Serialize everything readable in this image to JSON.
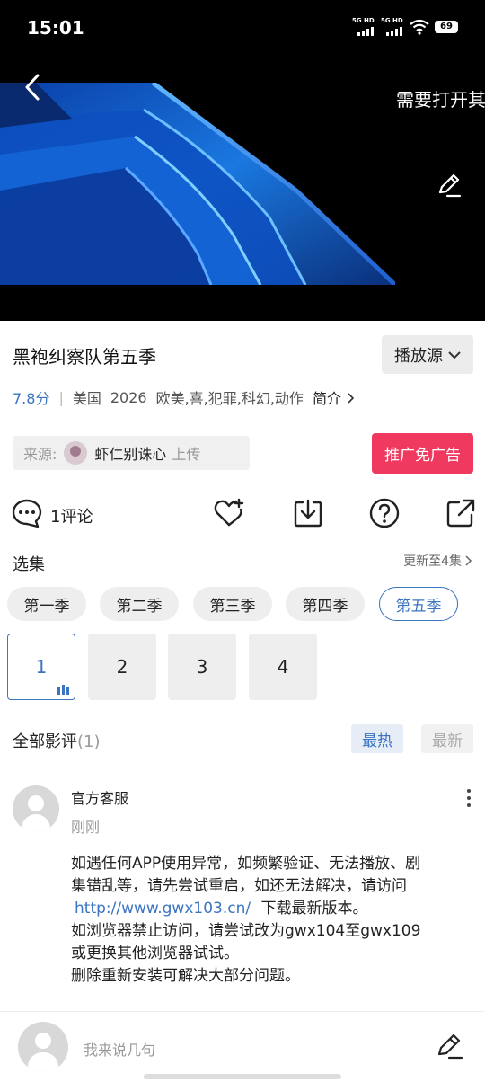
{
  "status_bar": {
    "time": "15:01",
    "sim1": "5G HD",
    "sim2": "5G HD",
    "battery": "69"
  },
  "hero": {
    "marquee": "需要打开其"
  },
  "show": {
    "title": "黑袍纠察队第五季",
    "source_button": "播放源",
    "score": "7.8分",
    "region": "美国",
    "year": "2026",
    "genres": "欧美,喜,犯罪,科幻,动作",
    "intro_link": "简介"
  },
  "source": {
    "label": "来源:",
    "uploader": "虾仁别诛心",
    "action": "上传"
  },
  "ad_button": "推广免广告",
  "actions": {
    "comment_count": "1评论"
  },
  "episodes": {
    "header": "选集",
    "update_info": "更新至4集",
    "seasons": [
      "第一季",
      "第二季",
      "第三季",
      "第四季",
      "第五季"
    ],
    "active_season": 4,
    "items": [
      "1",
      "2",
      "3",
      "4"
    ],
    "active_episode": 0
  },
  "reviews": {
    "header": "全部影评",
    "count": "(1)",
    "sort_hot": "最热",
    "sort_new": "最新",
    "items": [
      {
        "author": "官方客服",
        "time": "刚刚",
        "line1": "如遇任何APP使用异常，如频繁验证、无法播放、剧",
        "line2": "集错乱等，请先尝试重启，如还无法解决，请访问",
        "link": "http://www.gwx103.cn/",
        "line3_tail": "下载最新版本。",
        "line4": "如浏览器禁止访问，请尝试改为gwx104至gwx109",
        "line5": "或更换其他浏览器试试。",
        "line6": "删除重新安装可解决大部分问题。"
      }
    ]
  },
  "comment_input": {
    "placeholder": "我来说几句"
  },
  "colors": {
    "accent": "#3a74c2",
    "ad": "#f0395e"
  }
}
